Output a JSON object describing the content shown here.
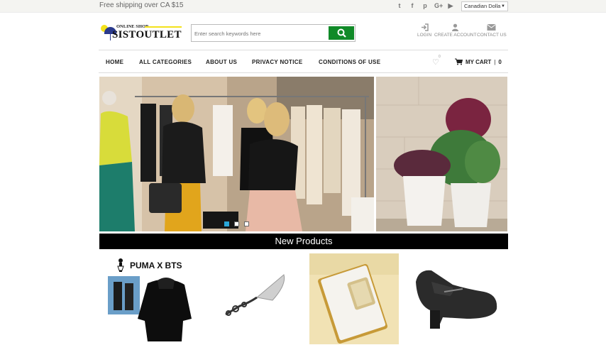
{
  "topbar": {
    "shipping_text": "Free shipping over CA $15",
    "social_icons": [
      "twitter-icon",
      "facebook-icon",
      "pinterest-icon",
      "google-plus-icon",
      "youtube-icon"
    ],
    "social_glyphs": [
      "t",
      "f",
      "p",
      "G+",
      "▶"
    ],
    "currency": "Canadian Dolla"
  },
  "logo": {
    "small_text": "ONLINE SHOP",
    "big_text": "SISTOUTLET"
  },
  "search": {
    "placeholder": "Enter search keywords here"
  },
  "account_links": {
    "login": "LOGIN",
    "create_account": "CREATE ACCOUNT",
    "contact_us": "CONTACT US"
  },
  "nav": {
    "items": [
      "HOME",
      "ALL CATEGORIES",
      "ABOUT US",
      "PRIVACY NOTICE",
      "CONDITIONS OF USE"
    ],
    "wishlist_count": "0",
    "cart_label": "MY CART",
    "cart_separator": "|",
    "cart_count": "0"
  },
  "banner": {
    "slides": 3,
    "active_slide": 0
  },
  "section": {
    "new_products": "New Products"
  },
  "products": [
    {
      "name": "PUMA X BTS hoodie",
      "image_text": "PUMA X BTS"
    },
    {
      "name": "cake server",
      "image_text": ""
    },
    {
      "name": "phone wallet case",
      "image_text": ""
    },
    {
      "name": "black mary jane shoe",
      "image_text": ""
    }
  ],
  "colors": {
    "search_button": "#108a28",
    "section_bar": "#000000",
    "active_dot": "#2aa6d8"
  }
}
